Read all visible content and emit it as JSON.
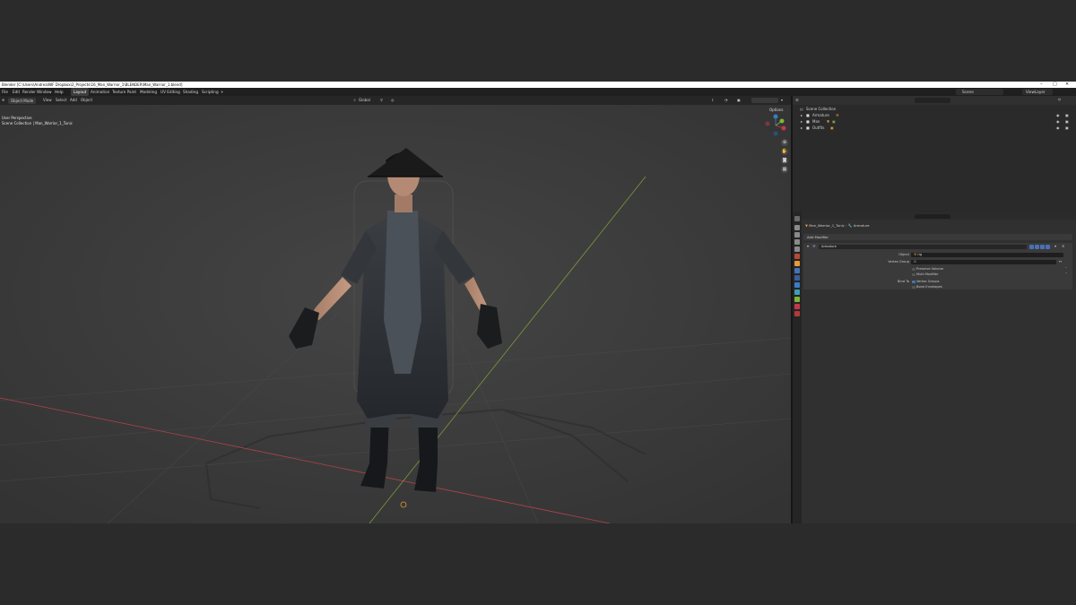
{
  "window": {
    "title": "Blender [C:\\Users\\Andrea\\NIF Dropbox\\2_Projects\\16_Man_Warrior_1\\BLENDER\\Man_Warrior_1.blend]",
    "controls": [
      "–",
      "□",
      "✕"
    ]
  },
  "menubar": {
    "menus": [
      "File",
      "Edit",
      "Render",
      "Window",
      "Help"
    ],
    "workspaces": [
      "Layout",
      "Animation",
      "Texture Paint",
      "Modeling",
      "UV Editing",
      "Shading",
      "Scripting",
      "+"
    ],
    "active_workspace": "Layout",
    "scene": "Scene",
    "view_layer": "ViewLayer"
  },
  "viewport": {
    "mode": "Object Mode",
    "menus": [
      "View",
      "Select",
      "Add",
      "Object"
    ],
    "orientation": "Global",
    "overlay_label": "Options",
    "info_line1": "User Perspective",
    "info_line2": "Scene Collection | Man_Warrior_1_Tunic",
    "gizmo_axes": [
      "X",
      "Y",
      "Z"
    ]
  },
  "outliner": {
    "root": "Scene Collection",
    "items": [
      {
        "label": "Armature"
      },
      {
        "label": "Man"
      },
      {
        "label": "Outfits"
      }
    ]
  },
  "properties": {
    "breadcrumb_object": "Man_Warrior_1_Tunic",
    "breadcrumb_modifier": "Armature",
    "add_modifier": "Add Modifier",
    "modifier_name": "Armature",
    "object_label": "Object",
    "object_value": "rig",
    "vertex_group_label": "Vertex Group",
    "preserve_volume": "Preserve Volume",
    "multi_modifier": "Multi Modifier",
    "bind_to_label": "Bind To",
    "vertex_groups": "Vertex Groups",
    "bone_envelopes": "Bone Envelopes"
  },
  "colors": {
    "accent": "#4772b3",
    "x_axis": "#c4394a",
    "y_axis": "#7fb33a",
    "z_axis": "#3a7cc4"
  }
}
